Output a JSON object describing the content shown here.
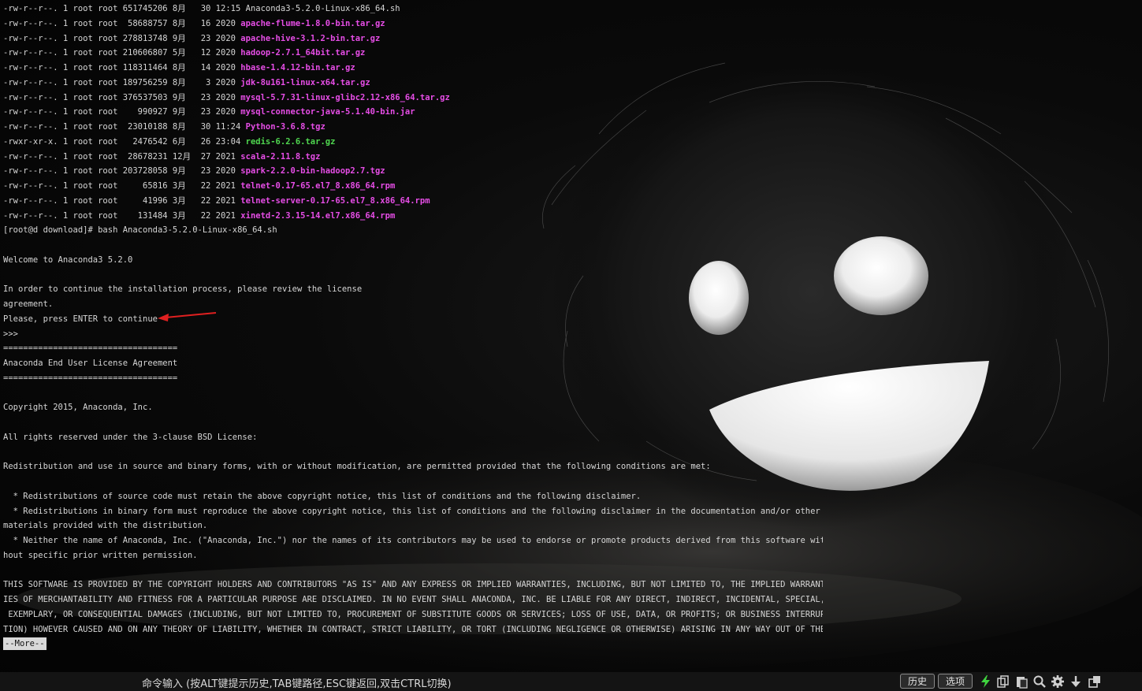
{
  "colors": {
    "text": "#d6d6d6",
    "archive": "#e64de6",
    "executable": "#4fd64f",
    "background": "#050505",
    "arrow": "#e02020"
  },
  "terminal": {
    "lines": [
      {
        "text": "-rw-r--r--. 1 root root 651745206 8月   30 12:15 ",
        "file": "Anaconda3-5.2.0-Linux-x86_64.sh",
        "kind": "plain"
      },
      {
        "text": "-rw-r--r--. 1 root root  58688757 8月   16 2020 ",
        "file": "apache-flume-1.8.0-bin.tar.gz",
        "kind": "archive"
      },
      {
        "text": "-rw-r--r--. 1 root root 278813748 9月   23 2020 ",
        "file": "apache-hive-3.1.2-bin.tar.gz",
        "kind": "archive"
      },
      {
        "text": "-rw-r--r--. 1 root root 210606807 5月   12 2020 ",
        "file": "hadoop-2.7.1_64bit.tar.gz",
        "kind": "archive"
      },
      {
        "text": "-rw-r--r--. 1 root root 118311464 8月   14 2020 ",
        "file": "hbase-1.4.12-bin.tar.gz",
        "kind": "archive"
      },
      {
        "text": "-rw-r--r--. 1 root root 189756259 8月    3 2020 ",
        "file": "jdk-8u161-linux-x64.tar.gz",
        "kind": "archive"
      },
      {
        "text": "-rw-r--r--. 1 root root 376537503 9月   23 2020 ",
        "file": "mysql-5.7.31-linux-glibc2.12-x86_64.tar.gz",
        "kind": "archive"
      },
      {
        "text": "-rw-r--r--. 1 root root    990927 9月   23 2020 ",
        "file": "mysql-connector-java-5.1.40-bin.jar",
        "kind": "archive"
      },
      {
        "text": "-rw-r--r--. 1 root root  23010188 8月   30 11:24 ",
        "file": "Python-3.6.8.tgz",
        "kind": "archive"
      },
      {
        "text": "-rwxr-xr-x. 1 root root   2476542 6月   26 23:04 ",
        "file": "redis-6.2.6.tar.gz",
        "kind": "executable"
      },
      {
        "text": "-rw-r--r--. 1 root root  28678231 12月  27 2021 ",
        "file": "scala-2.11.8.tgz",
        "kind": "archive"
      },
      {
        "text": "-rw-r--r--. 1 root root 203728058 9月   23 2020 ",
        "file": "spark-2.2.0-bin-hadoop2.7.tgz",
        "kind": "archive"
      },
      {
        "text": "-rw-r--r--. 1 root root     65816 3月   22 2021 ",
        "file": "telnet-0.17-65.el7_8.x86_64.rpm",
        "kind": "archive"
      },
      {
        "text": "-rw-r--r--. 1 root root     41996 3月   22 2021 ",
        "file": "telnet-server-0.17-65.el7_8.x86_64.rpm",
        "kind": "archive"
      },
      {
        "text": "-rw-r--r--. 1 root root    131484 3月   22 2021 ",
        "file": "xinetd-2.3.15-14.el7.x86_64.rpm",
        "kind": "archive"
      },
      {
        "text": "[root@d download]# bash Anaconda3-5.2.0-Linux-x86_64.sh",
        "file": "",
        "kind": "plain"
      },
      {
        "text": "",
        "file": "",
        "kind": "plain"
      },
      {
        "text": "Welcome to Anaconda3 5.2.0",
        "file": "",
        "kind": "plain"
      },
      {
        "text": "",
        "file": "",
        "kind": "plain"
      },
      {
        "text": "In order to continue the installation process, please review the license",
        "file": "",
        "kind": "plain"
      },
      {
        "text": "agreement.",
        "file": "",
        "kind": "plain"
      },
      {
        "text": "Please, press ENTER to continue",
        "file": "",
        "kind": "plain"
      },
      {
        "text": ">>>",
        "file": "",
        "kind": "plain"
      },
      {
        "text": "===================================",
        "file": "",
        "kind": "plain"
      },
      {
        "text": "Anaconda End User License Agreement",
        "file": "",
        "kind": "plain"
      },
      {
        "text": "===================================",
        "file": "",
        "kind": "plain"
      },
      {
        "text": "",
        "file": "",
        "kind": "plain"
      },
      {
        "text": "Copyright 2015, Anaconda, Inc.",
        "file": "",
        "kind": "plain"
      },
      {
        "text": "",
        "file": "",
        "kind": "plain"
      },
      {
        "text": "All rights reserved under the 3-clause BSD License:",
        "file": "",
        "kind": "plain"
      },
      {
        "text": "",
        "file": "",
        "kind": "plain"
      },
      {
        "text": "Redistribution and use in source and binary forms, with or without modification, are permitted provided that the following conditions are met:",
        "file": "",
        "kind": "plain"
      },
      {
        "text": "",
        "file": "",
        "kind": "plain"
      },
      {
        "text": "  * Redistributions of source code must retain the above copyright notice, this list of conditions and the following disclaimer.",
        "file": "",
        "kind": "plain"
      },
      {
        "text": "  * Redistributions in binary form must reproduce the above copyright notice, this list of conditions and the following disclaimer in the documentation and/or other",
        "file": "",
        "kind": "plain"
      },
      {
        "text": "materials provided with the distribution.",
        "file": "",
        "kind": "plain"
      },
      {
        "text": "  * Neither the name of Anaconda, Inc. (\"Anaconda, Inc.\") nor the names of its contributors may be used to endorse or promote products derived from this software wit",
        "file": "",
        "kind": "plain"
      },
      {
        "text": "hout specific prior written permission.",
        "file": "",
        "kind": "plain"
      },
      {
        "text": "",
        "file": "",
        "kind": "plain"
      },
      {
        "text": "THIS SOFTWARE IS PROVIDED BY THE COPYRIGHT HOLDERS AND CONTRIBUTORS \"AS IS\" AND ANY EXPRESS OR IMPLIED WARRANTIES, INCLUDING, BUT NOT LIMITED TO, THE IMPLIED WARRANT",
        "file": "",
        "kind": "plain"
      },
      {
        "text": "IES OF MERCHANTABILITY AND FITNESS FOR A PARTICULAR PURPOSE ARE DISCLAIMED. IN NO EVENT SHALL ANACONDA, INC. BE LIABLE FOR ANY DIRECT, INDIRECT, INCIDENTAL, SPECIAL,",
        "file": "",
        "kind": "plain"
      },
      {
        "text": " EXEMPLARY, OR CONSEQUENTIAL DAMAGES (INCLUDING, BUT NOT LIMITED TO, PROCUREMENT OF SUBSTITUTE GOODS OR SERVICES; LOSS OF USE, DATA, OR PROFITS; OR BUSINESS INTERRUP",
        "file": "",
        "kind": "plain"
      },
      {
        "text": "TION) HOWEVER CAUSED AND ON ANY THEORY OF LIABILITY, WHETHER IN CONTRACT, STRICT LIABILITY, OR TORT (INCLUDING NEGLIGENCE OR OTHERWISE) ARISING IN ANY WAY OUT OF THE",
        "file": "",
        "kind": "plain"
      }
    ],
    "more_prompt": "--More--"
  },
  "command_bar": {
    "hint": "命令输入 (按ALT键提示历史,TAB键路径,ESC键返回,双击CTRL切换)",
    "history_label": "历史",
    "options_label": "选项",
    "icons": [
      "lightning-icon",
      "copy-icon",
      "paste-icon",
      "search-icon",
      "gear-icon",
      "download-icon",
      "window-icon"
    ]
  }
}
